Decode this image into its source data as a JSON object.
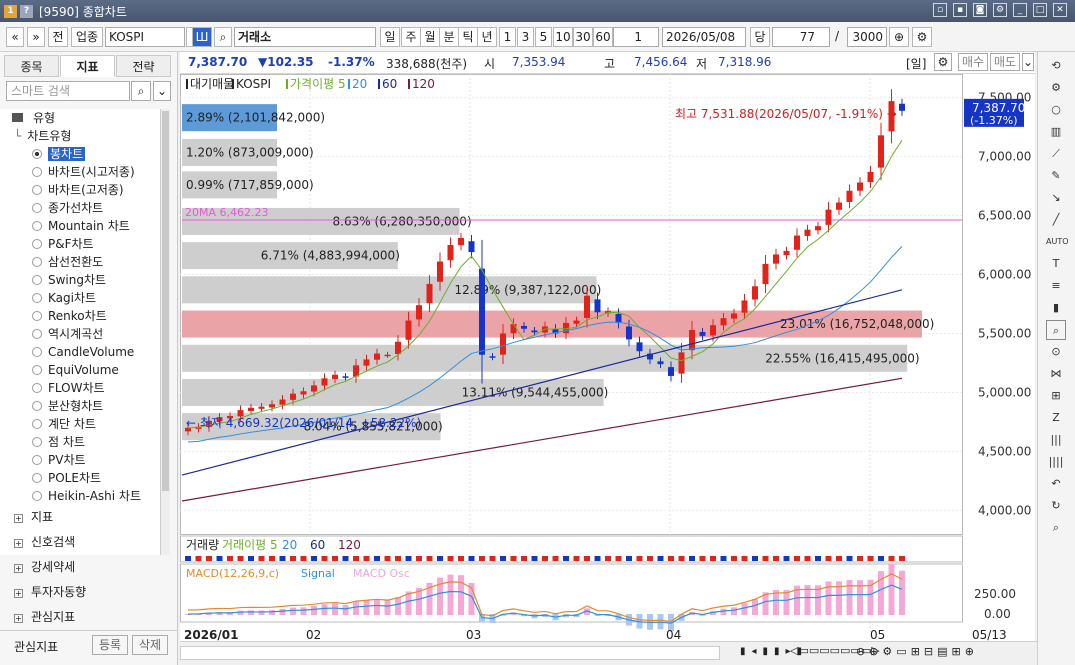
{
  "window": {
    "title": "[9590] 종합차트"
  },
  "toolbar": {
    "prev": "«",
    "menu": "»",
    "jeon": "전",
    "sector": "업종",
    "code": "KOSPI",
    "market": "거래소",
    "periods": [
      "일",
      "주",
      "월",
      "분",
      "틱",
      "년"
    ],
    "selected_period": "일",
    "ticks": [
      "1",
      "3",
      "5",
      "10",
      "30",
      "60"
    ],
    "count": "1",
    "date": "2026/05/08",
    "dang": "당",
    "num": "77",
    "slash": "/",
    "total": "3000"
  },
  "left": {
    "tabs": [
      "종목",
      "지표",
      "전략"
    ],
    "active_tab": "지표",
    "search_placeholder": "스마트 검색",
    "group_label": "유형",
    "sub_label": "차트유형",
    "items": [
      "봉차트",
      "바차트(시고저종)",
      "바차트(고저종)",
      "종가선차트",
      "Mountain 차트",
      "P&F차트",
      "삼선전환도",
      "Swing차트",
      "Kagi차트",
      "Renko차트",
      "역시계곡선",
      "CandleVolume",
      "EquiVolume",
      "FLOW차트",
      "분산형차트",
      "계단 차트",
      "점 차트",
      "PV차트",
      "POLE차트",
      "Heikin-Ashi 차트"
    ],
    "sections": [
      "지표",
      "신호검색",
      "강세약세",
      "투자자동향",
      "관심지표"
    ],
    "footer_label": "관심지표",
    "register": "등록",
    "delete": "삭제"
  },
  "info": {
    "price": "7,387.70",
    "change": "▼102.35",
    "pct": "-1.37%",
    "volume": "338,688(천주)",
    "open_label": "시",
    "open": "7,353.94",
    "high_label": "고",
    "high": "7,456.64",
    "low_label": "저",
    "low": "7,318.96",
    "unit": "[일]",
    "buy": "매수",
    "sell": "매도"
  },
  "legend": {
    "main": [
      "대기매물",
      "KOSPI",
      "가격이평 5",
      "20",
      "60",
      "120"
    ],
    "volume": [
      "거래량",
      "거래이평 5",
      "20",
      "60",
      "120"
    ],
    "macd": [
      "MACD(12,26,9,c)",
      "Signal",
      "MACD Osc"
    ]
  },
  "annotations": {
    "high": "최고 7,531.88(2026/05/07, -1.91%)",
    "low": "최저 4,669.32(2026/01/14, +58.22%)",
    "ma20": "20MA 6,462.23",
    "current_price": "7,387.70",
    "current_pct": "(-1.37%)"
  },
  "chart_data": {
    "type": "candlestick",
    "y_ticks": [
      "7,500.00",
      "7,000.00",
      "6,500.00",
      "6,000.00",
      "5,500.00",
      "5,000.00",
      "4,500.00",
      "4,000.00"
    ],
    "ylim": [
      3800,
      7700
    ],
    "x_labels": [
      "2026/01",
      "02",
      "03",
      "04",
      "05",
      "05/13"
    ],
    "macd_ticks": [
      "250.00",
      "0.00"
    ],
    "volume_profile": [
      {
        "label": "2.89% (2,101,842,000)",
        "pct": 2.89,
        "highlight": "blue"
      },
      {
        "label": "1.20% (873,009,000)",
        "pct": 1.2
      },
      {
        "label": "0.99% (717,859,000)",
        "pct": 0.99
      },
      {
        "label": "8.63% (6,280,350,000)",
        "pct": 8.63
      },
      {
        "label": "6.71% (4,883,994,000)",
        "pct": 6.71
      },
      {
        "label": "12.89% (9,387,122,000)",
        "pct": 12.89
      },
      {
        "label": "23.01% (16,752,048,000)",
        "pct": 23.01,
        "highlight": "red"
      },
      {
        "label": "22.55% (16,415,495,000)",
        "pct": 22.55
      },
      {
        "label": "13.11% (9,544,455,000)",
        "pct": 13.11
      },
      {
        "label": "8.04% (5,855,821,000)",
        "pct": 8.04
      }
    ],
    "close": [
      4700,
      4710,
      4760,
      4790,
      4800,
      4850,
      4870,
      4880,
      4900,
      4940,
      4990,
      5010,
      5060,
      5120,
      5150,
      5130,
      5230,
      5280,
      5330,
      5320,
      5430,
      5610,
      5740,
      5920,
      6110,
      6250,
      6310,
      6190,
      5320,
      5300,
      5500,
      5580,
      5540,
      5510,
      5560,
      5500,
      5590,
      5610,
      5820,
      5680,
      5690,
      5590,
      5450,
      5350,
      5280,
      5240,
      5140,
      5340,
      5530,
      5480,
      5570,
      5630,
      5670,
      5780,
      5900,
      6090,
      6170,
      6200,
      6330,
      6380,
      6410,
      6550,
      6610,
      6710,
      6780,
      6870,
      7180,
      7470,
      7388
    ],
    "ma120_start": 4080,
    "ma120_end": 5120,
    "ma60_start": 4300,
    "ma60_end": 5870
  }
}
